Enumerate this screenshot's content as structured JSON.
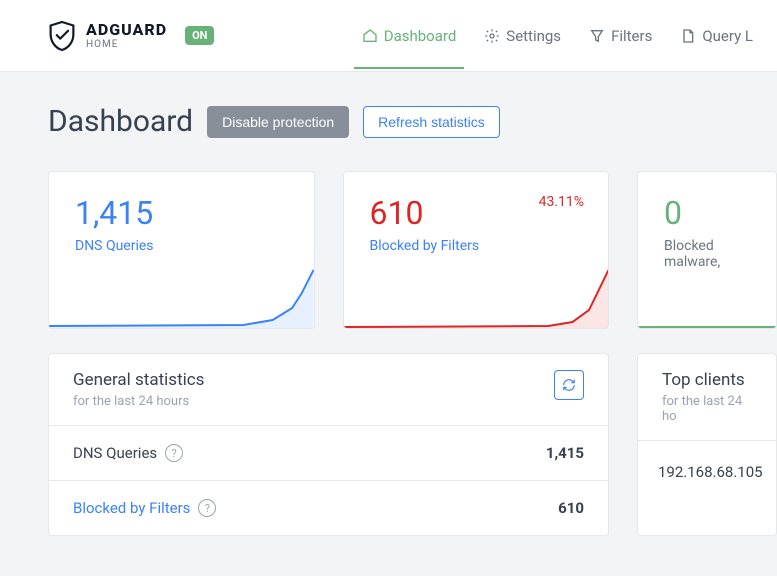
{
  "brand": {
    "title": "ADGUARD",
    "sub": "HOME",
    "badge": "ON"
  },
  "nav": {
    "dashboard": "Dashboard",
    "settings": "Settings",
    "filters": "Filters",
    "querylog": "Query L"
  },
  "page": {
    "title": "Dashboard",
    "disable_btn": "Disable protection",
    "refresh_btn": "Refresh statistics"
  },
  "cards": {
    "dns": {
      "value": "1,415",
      "label": "DNS Queries"
    },
    "blocked": {
      "value": "610",
      "label": "Blocked by Filters",
      "pct": "43.11%"
    },
    "malware": {
      "value": "0",
      "label": "Blocked malware,"
    }
  },
  "general": {
    "title": "General statistics",
    "sub": "for the last 24 hours",
    "rows": [
      {
        "label": "DNS Queries",
        "value": "1,415",
        "blue": false
      },
      {
        "label": "Blocked by Filters",
        "value": "610",
        "blue": true
      }
    ]
  },
  "clients": {
    "title": "Top clients",
    "sub": "for the last 24 ho",
    "items": [
      "192.168.68.105"
    ]
  }
}
